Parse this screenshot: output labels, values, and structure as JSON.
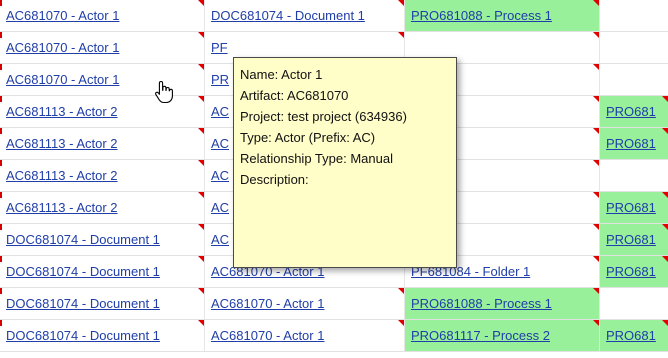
{
  "rows": [
    {
      "c1": "AC681070 - Actor 1",
      "c2": "DOC681074 - Document 1",
      "c3": "PRO681088 - Process 1",
      "c4": "",
      "c3_green": true,
      "c4_green": false
    },
    {
      "c1": "AC681070 - Actor 1",
      "c2": "PF",
      "c3": "",
      "c4": "",
      "c3_green": false,
      "c4_green": false
    },
    {
      "c1": "AC681070 - Actor 1",
      "c2": "PR",
      "c3": "",
      "c4": "",
      "c3_green": false,
      "c4_green": false
    },
    {
      "c1": "AC681113 - Actor 2",
      "c2": "AC",
      "c3": "",
      "c4": "PRO681",
      "c3_green": false,
      "c4_green": true
    },
    {
      "c1": "AC681113 - Actor 2",
      "c2": "AC",
      "c3": "",
      "c4": "PRO681",
      "c3_green": false,
      "c4_green": true
    },
    {
      "c1": "AC681113 - Actor 2",
      "c2": "AC",
      "c3": "",
      "c4": "",
      "c3_green": false,
      "c4_green": false
    },
    {
      "c1": "AC681113 - Actor 2",
      "c2": "AC",
      "c3": "",
      "c4": "PRO681",
      "c3_green": false,
      "c4_green": true
    },
    {
      "c1": "DOC681074 - Document 1",
      "c2": "AC",
      "c3": "",
      "c4": "PRO681",
      "c3_green": false,
      "c4_green": true
    },
    {
      "c1": "DOC681074 - Document 1",
      "c2": "AC681070 - Actor 1",
      "c3": "PF681084 - Folder 1",
      "c4": "PRO681",
      "c3_green": false,
      "c4_green": true
    },
    {
      "c1": "DOC681074 - Document 1",
      "c2": "AC681070 - Actor 1",
      "c3": "PRO681088 - Process 1",
      "c4": "",
      "c3_green": true,
      "c4_green": false
    },
    {
      "c1": "DOC681074 - Document 1",
      "c2": "AC681070 - Actor 1",
      "c3": "PRO681117 - Process 2",
      "c4": "PRO681",
      "c3_green": true,
      "c4_green": true
    }
  ],
  "tooltip": {
    "name": "Name: Actor 1",
    "artifact": "Artifact: AC681070",
    "project": "Project: test project (634936)",
    "type": "Type: Actor (Prefix: AC)",
    "relationship": "Relationship Type: Manual",
    "description": "Description:"
  },
  "icons": {
    "cursor": "hand-pointer-icon",
    "comment_marker": "red-triangle-icon"
  },
  "colors": {
    "link": "#1f3ea8",
    "green_cell": "#98f09a",
    "tooltip_bg": "#fffdc8",
    "marker": "#e00000"
  }
}
